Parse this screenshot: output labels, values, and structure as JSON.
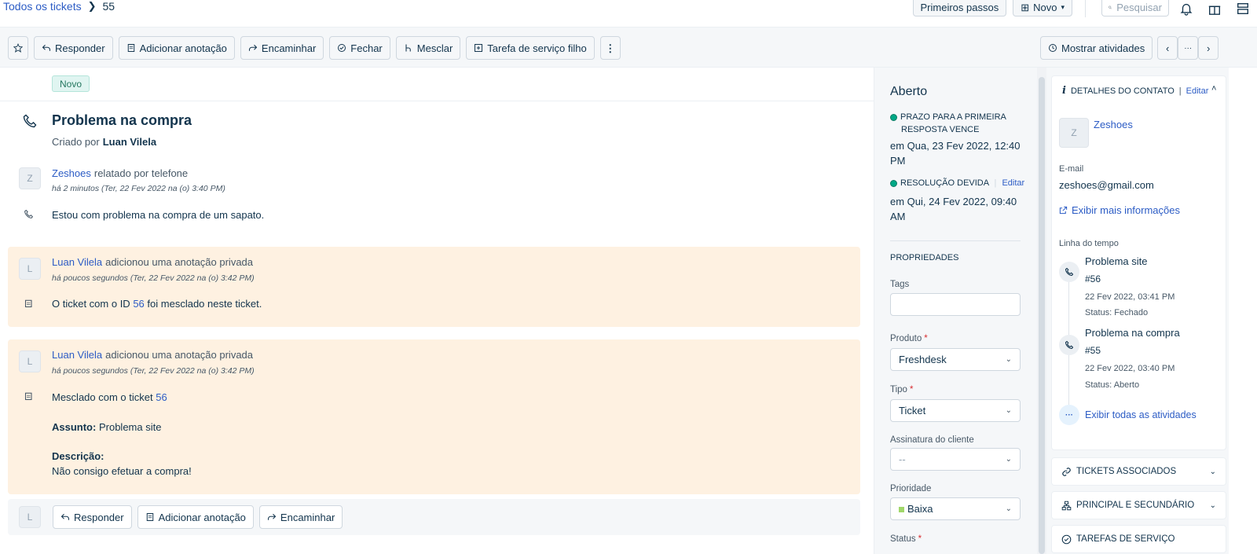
{
  "breadcrumb": {
    "all_tickets": "Todos os tickets",
    "ticket_number": "55"
  },
  "header": {
    "getting_started": "Primeiros passos",
    "new": "Novo",
    "search_placeholder": "Pesquisar"
  },
  "toolbar": {
    "reply": "Responder",
    "add_note": "Adicionar anotação",
    "forward": "Encaminhar",
    "close": "Fechar",
    "merge": "Mesclar",
    "child_task": "Tarefa de serviço filho",
    "show_activities": "Mostrar atividades",
    "more": "···"
  },
  "ticket": {
    "status_tag": "Novo",
    "title": "Problema na compra",
    "created_by_label": "Criado por",
    "created_by": "Luan Vilela"
  },
  "conversation": {
    "avatar": "Z",
    "who": "Zeshoes",
    "action": "relatado por telefone",
    "when": "há 2 minutos (Ter, 22 Fev 2022 na (o) 3:40 PM)",
    "body": "Estou com problema na compra de um sapato."
  },
  "notes": [
    {
      "avatar": "L",
      "who": "Luan Vilela",
      "action": "adicionou uma anotação privada",
      "when": "há poucos segundos (Ter, 22 Fev 2022 na (o) 3:42 PM)",
      "body_pre": "O ticket com o ID",
      "body_link": "56",
      "body_post": "foi mesclado neste ticket."
    },
    {
      "avatar": "L",
      "who": "Luan Vilela",
      "action": "adicionou uma anotação privada",
      "when": "há poucos segundos (Ter, 22 Fev 2022 na (o) 3:42 PM)",
      "body_pre": "Mesclado com o ticket",
      "body_link": "56",
      "subject_label": "Assunto:",
      "subject": "Problema site",
      "desc_label": "Descrição:",
      "desc": "Não consigo efetuar a compra!"
    }
  ],
  "reply_bar": {
    "avatar": "L",
    "reply": "Responder",
    "add_note": "Adicionar anotação",
    "forward": "Encaminhar"
  },
  "properties": {
    "state": "Aberto",
    "first_response_line1": "PRAZO PARA A PRIMEIRA",
    "first_response_line2": "RESPOSTA VENCE",
    "first_response_date1": "em Qua, 23 Fev 2022, 12:40",
    "first_response_date2": "PM",
    "resolution_label": "RESOLUÇÃO DEVIDA",
    "edit": "Editar",
    "resolution_date1": "em Qui, 24 Fev 2022, 09:40",
    "resolution_date2": "AM",
    "section": "PROPRIEDADES",
    "tags_label": "Tags",
    "product_label": "Produto",
    "product_value": "Freshdesk",
    "type_label": "Tipo",
    "type_value": "Ticket",
    "signature_label": "Assinatura do cliente",
    "signature_value": "--",
    "priority_label": "Prioridade",
    "priority_value": "Baixa",
    "priority_color": "#a0d76a",
    "status_label": "Status",
    "required": "*"
  },
  "contact": {
    "title": "DETALHES DO CONTATO",
    "separator": "|",
    "edit": "Editar",
    "avatar": "Z",
    "name": "Zeshoes",
    "email_label": "E-mail",
    "email": "zeshoes@gmail.com",
    "more_info": "Exibir mais informações",
    "timeline_label": "Linha do tempo",
    "timeline": [
      {
        "title": "Problema site",
        "id": "#56",
        "date": "22 Fev 2022, 03:41 PM",
        "status": "Status: Fechado"
      },
      {
        "title": "Problema na compra",
        "id": "#55",
        "date": "22 Fev 2022, 03:40 PM",
        "status": "Status: Aberto"
      }
    ],
    "all_activities": "Exibir todas as atividades",
    "associated": "TICKETS ASSOCIADOS",
    "parent_child": "PRINCIPAL E SECUNDÁRIO",
    "service_tasks": "TAREFAS DE SERVIÇO"
  }
}
